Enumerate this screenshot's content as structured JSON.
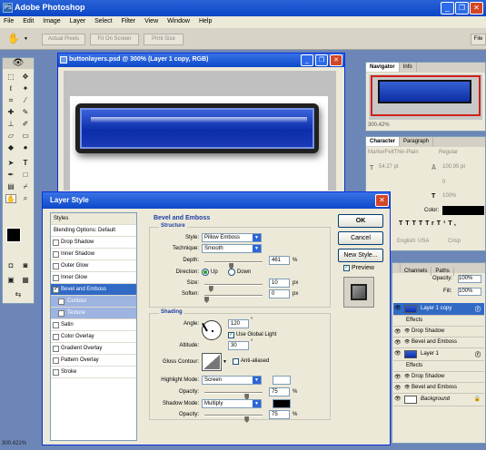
{
  "app": {
    "title": "Adobe Photoshop",
    "logo_text": "Ps",
    "window_buttons": {
      "minimize": "_",
      "restore": "❐",
      "close": "✕"
    }
  },
  "menu": [
    "File",
    "Edit",
    "Image",
    "Layer",
    "Select",
    "Filter",
    "View",
    "Window",
    "Help"
  ],
  "options_bar": {
    "buttons": [
      "Actual Pixels",
      "Fit On Screen",
      "Print Size"
    ],
    "file_browser": "File"
  },
  "document": {
    "title": "buttonlayers.psd @ 300% (Layer 1 copy, RGB)",
    "zoom_status": "300.421%"
  },
  "navigator": {
    "tabs": [
      "Navigator",
      "Info"
    ],
    "zoom": "300.42%"
  },
  "character": {
    "tabs": [
      "Character",
      "Paragraph"
    ],
    "font": "MarkerFeltThin-Plain",
    "style": "Regular",
    "size": "54.27 pt",
    "leading": "100.95 pt",
    "tracking": "0",
    "scale_v": "100%",
    "color_label": "Color:",
    "lang": "English: USA",
    "aa": "Crisp",
    "styles": [
      "T",
      "T",
      "TT",
      "Tr",
      "T¹",
      "T,",
      "T",
      "Ŧ"
    ]
  },
  "layers": {
    "tabs": [
      "Channels",
      "Paths"
    ],
    "opacity_label": "Opacity:",
    "opacity": "100%",
    "fill_label": "Fill:",
    "fill": "100%",
    "rows": [
      {
        "name": "Layer 1 copy",
        "kind": "layer"
      },
      {
        "name": "Effects",
        "kind": "effects"
      },
      {
        "name": "Drop Shadow",
        "kind": "effect"
      },
      {
        "name": "Bevel and Emboss",
        "kind": "effect"
      },
      {
        "name": "Layer 1",
        "kind": "layer"
      },
      {
        "name": "Effects",
        "kind": "effects"
      },
      {
        "name": "Drop Shadow",
        "kind": "effect"
      },
      {
        "name": "Bevel and Emboss",
        "kind": "effect"
      },
      {
        "name": "Background",
        "kind": "bg"
      }
    ]
  },
  "dialog": {
    "title": "Layer Style",
    "styles_header": "Styles",
    "blending": "Blending Options: Default",
    "style_items": [
      {
        "label": "Drop Shadow",
        "checked": false
      },
      {
        "label": "Inner Shadow",
        "checked": false
      },
      {
        "label": "Outer Glow",
        "checked": false
      },
      {
        "label": "Inner Glow",
        "checked": false
      },
      {
        "label": "Bevel and Emboss",
        "checked": true
      },
      {
        "label": "Contour",
        "checked": false
      },
      {
        "label": "Texture",
        "checked": false
      },
      {
        "label": "Satin",
        "checked": false
      },
      {
        "label": "Color Overlay",
        "checked": false
      },
      {
        "label": "Gradient Overlay",
        "checked": false
      },
      {
        "label": "Pattern Overlay",
        "checked": false
      },
      {
        "label": "Stroke",
        "checked": false
      }
    ],
    "section_title": "Bevel and Emboss",
    "structure_title": "Structure",
    "style_label": "Style:",
    "style_value": "Pillow Emboss",
    "technique_label": "Technique:",
    "technique_value": "Smooth",
    "depth_label": "Depth:",
    "depth_value": "461",
    "depth_level": 0.46,
    "direction_label": "Direction:",
    "direction_up": "Up",
    "direction_down": "Down",
    "size_label": "Size:",
    "size_value": "10",
    "size_level": 0.08,
    "soften_label": "Soften:",
    "soften_value": "0",
    "soften_level": 0,
    "shading_title": "Shading",
    "angle_label": "Angle:",
    "angle_value": "120",
    "use_global": "Use Global Light",
    "altitude_label": "Altitude:",
    "altitude_value": "30",
    "gloss_label": "Gloss Contour:",
    "anti_aliased": "Anti-aliased",
    "highlight_label": "Highlight Mode:",
    "highlight_value": "Screen",
    "highlight_color": "#ffffff",
    "hl_opacity_label": "Opacity:",
    "hl_opacity_value": "75",
    "hl_opacity_level": 0.75,
    "shadow_label": "Shadow Mode:",
    "shadow_value": "Multiply",
    "shadow_color": "#000000",
    "sh_opacity_label": "Opacity:",
    "sh_opacity_value": "75",
    "sh_opacity_level": 0.75,
    "percent": "%",
    "px": "px",
    "degree": "°",
    "ok": "OK",
    "cancel": "Cancel",
    "new_style": "New Style...",
    "preview": "Preview"
  }
}
